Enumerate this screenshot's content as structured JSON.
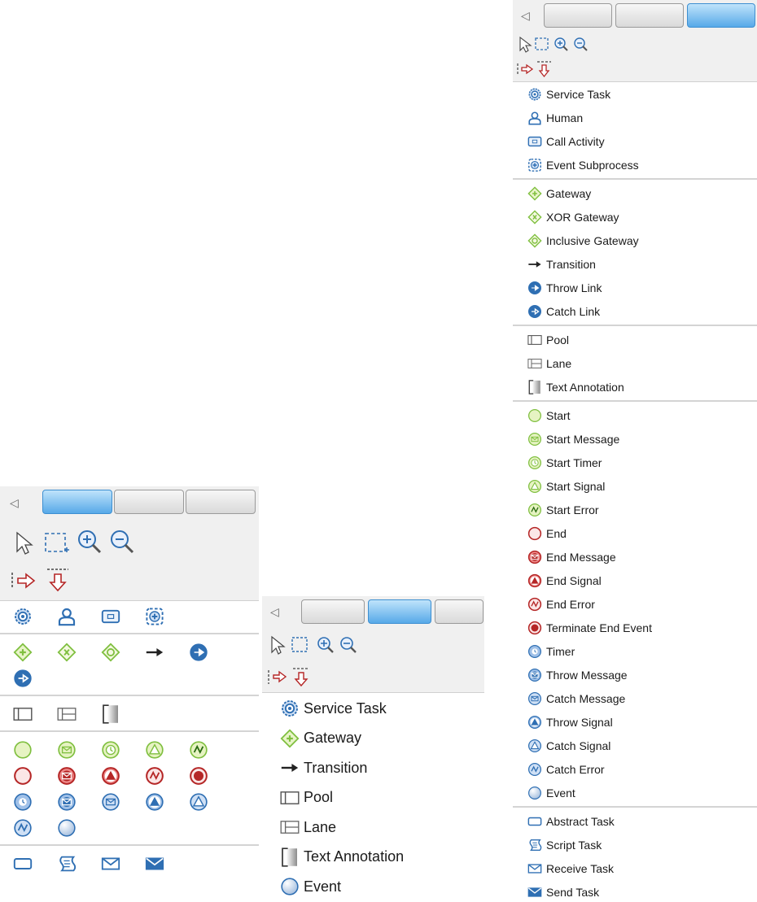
{
  "palettes": {
    "expanded": {
      "sections": [
        [
          {
            "icon": "service-task",
            "label": "Service Task"
          },
          {
            "icon": "human",
            "label": "Human"
          },
          {
            "icon": "call-activity",
            "label": "Call Activity"
          },
          {
            "icon": "event-subprocess",
            "label": "Event Subprocess"
          }
        ],
        [
          {
            "icon": "gateway",
            "label": "Gateway"
          },
          {
            "icon": "xor-gateway",
            "label": "XOR Gateway"
          },
          {
            "icon": "inclusive-gateway",
            "label": "Inclusive Gateway"
          },
          {
            "icon": "transition",
            "label": "Transition"
          },
          {
            "icon": "throw-link",
            "label": "Throw Link"
          },
          {
            "icon": "catch-link",
            "label": "Catch Link"
          }
        ],
        [
          {
            "icon": "pool",
            "label": "Pool"
          },
          {
            "icon": "lane",
            "label": "Lane"
          },
          {
            "icon": "text-annotation",
            "label": "Text Annotation"
          }
        ],
        [
          {
            "icon": "start",
            "label": "Start"
          },
          {
            "icon": "start-message",
            "label": "Start Message"
          },
          {
            "icon": "start-timer",
            "label": "Start Timer"
          },
          {
            "icon": "start-signal",
            "label": "Start Signal"
          },
          {
            "icon": "start-error",
            "label": "Start Error"
          },
          {
            "icon": "end",
            "label": "End"
          },
          {
            "icon": "end-message",
            "label": "End Message"
          },
          {
            "icon": "end-signal",
            "label": "End Signal"
          },
          {
            "icon": "end-error",
            "label": "End Error"
          },
          {
            "icon": "terminate-end",
            "label": "Terminate End Event"
          },
          {
            "icon": "timer",
            "label": "Timer"
          },
          {
            "icon": "throw-message",
            "label": "Throw Message"
          },
          {
            "icon": "catch-message",
            "label": "Catch Message"
          },
          {
            "icon": "throw-signal",
            "label": "Throw Signal"
          },
          {
            "icon": "catch-signal",
            "label": "Catch Signal"
          },
          {
            "icon": "catch-error",
            "label": "Catch Error"
          },
          {
            "icon": "event",
            "label": "Event"
          }
        ],
        [
          {
            "icon": "abstract-task",
            "label": "Abstract Task"
          },
          {
            "icon": "script-task",
            "label": "Script Task"
          },
          {
            "icon": "receive-task",
            "label": "Receive Task"
          },
          {
            "icon": "send-task",
            "label": "Send Task"
          }
        ]
      ]
    },
    "medium": {
      "items": [
        {
          "icon": "service-task",
          "label": "Service Task"
        },
        {
          "icon": "gateway",
          "label": "Gateway"
        },
        {
          "icon": "transition",
          "label": "Transition"
        },
        {
          "icon": "pool",
          "label": "Pool"
        },
        {
          "icon": "lane",
          "label": "Lane"
        },
        {
          "icon": "text-annotation",
          "label": "Text Annotation"
        },
        {
          "icon": "event",
          "label": "Event"
        }
      ]
    },
    "icons": {
      "rows": [
        [
          "service-task",
          "human",
          "call-activity",
          "event-subprocess"
        ],
        [
          "gateway",
          "xor-gateway",
          "inclusive-gateway",
          "transition",
          "throw-link",
          "catch-link"
        ],
        [
          "pool",
          "lane",
          "text-annotation"
        ],
        [
          "start",
          "start-message",
          "start-timer",
          "start-signal",
          "start-error",
          "end",
          "end-message",
          "end-signal",
          "end-error",
          "terminate-end",
          "timer",
          "throw-message",
          "catch-message",
          "throw-signal",
          "catch-signal",
          "catch-error",
          "event"
        ],
        [
          "abstract-task",
          "script-task",
          "receive-task",
          "send-task"
        ]
      ]
    }
  },
  "colors": {
    "bpmn_blue": "#2f6fb3",
    "bpmn_green": "#7fbf3f",
    "bpmn_red": "#b52626",
    "toolbar_bg": "#f0f0f0",
    "active_view": "#57a9e8"
  }
}
